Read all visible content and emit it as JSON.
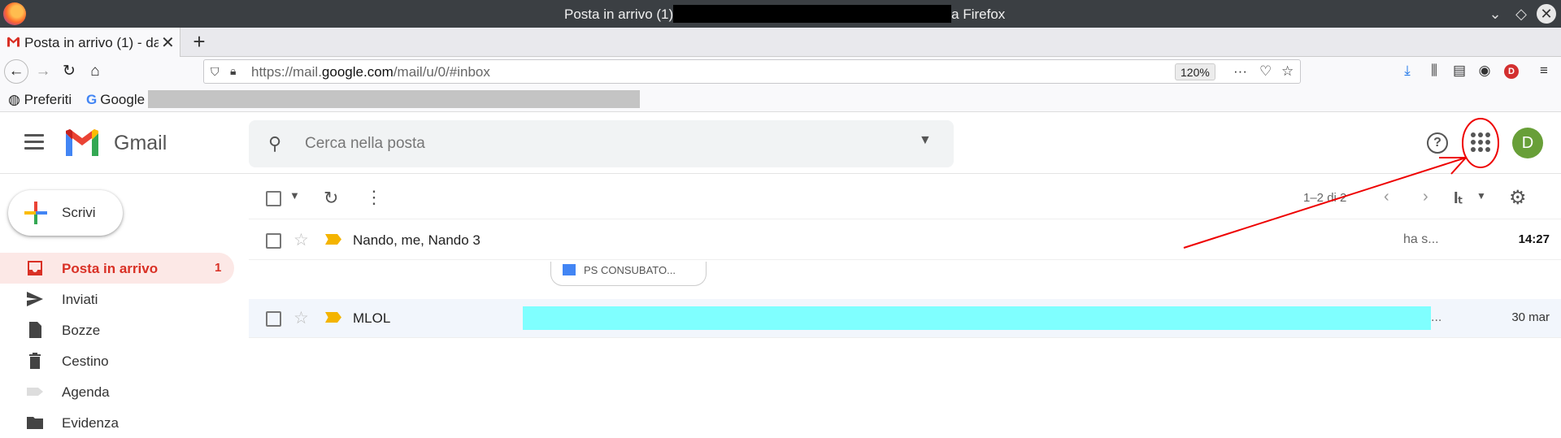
{
  "browser": {
    "window_title_prefix": "Posta in arrivo (1)",
    "window_title_suffix": "a Firefox",
    "window_buttons": [
      "⌄",
      "◇",
      "✕"
    ],
    "tab_title": "Posta in arrivo (1) - da",
    "tab_close": "✕",
    "new_tab": "+",
    "nav": {
      "back": "←",
      "forward": "→",
      "reload": "↻",
      "home": "⌂"
    },
    "url_prefix": "https://mail.",
    "url_domain": "google.com",
    "url_path": "/mail/u/0/#inbox",
    "zoom": "120%",
    "url_icons": {
      "more": "···",
      "pocket": "♡",
      "bookmark": "☆"
    },
    "toolbar": {
      "download": "⤓",
      "library": "⫼",
      "sidebar": "▤",
      "account": "◉",
      "profile_letter": "D",
      "menu": "≡"
    },
    "bookmarks": [
      {
        "icon": "globe-icon",
        "label": "Preferiti"
      },
      {
        "icon": "google-icon",
        "label": "Google"
      }
    ]
  },
  "gmail": {
    "logo_text": "Gmail",
    "search_placeholder": "Cerca nella posta",
    "help": "?",
    "avatar_letter": "D",
    "compose_label": "Scrivi",
    "nav_items": [
      {
        "label": "Posta in arrivo",
        "count": "1",
        "active": true,
        "icon": "inbox-icon"
      },
      {
        "label": "Inviati",
        "icon": "send-icon"
      },
      {
        "label": "Bozze",
        "icon": "draft-icon"
      },
      {
        "label": "Cestino",
        "icon": "trash-icon"
      },
      {
        "label": "Agenda",
        "icon": "label-icon"
      },
      {
        "label": "Evidenza",
        "icon": "folder-icon"
      }
    ],
    "toolbar": {
      "pager": "1–2 di 2"
    },
    "mails": [
      {
        "sender": "Nando, me, Nando 3",
        "snippet": "ha s...",
        "date": "14:27",
        "unread": true,
        "attachment": "PS CONSUBATO..."
      },
      {
        "sender": "MLOL",
        "snippet": "...",
        "date": "30 mar",
        "unread": false
      }
    ]
  }
}
